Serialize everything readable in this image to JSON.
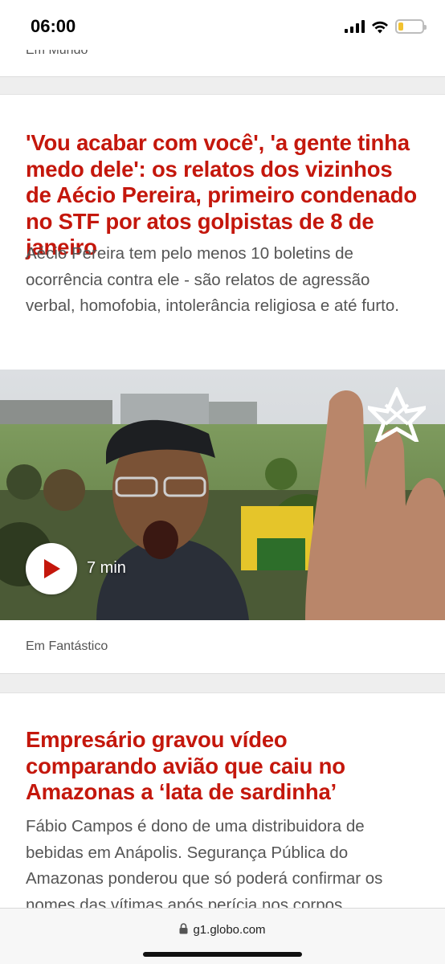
{
  "status_bar": {
    "time": "06:00",
    "battery_percent": 20
  },
  "top_card": {
    "source": "Em Mundo"
  },
  "article_1": {
    "headline": "'Vou acabar com você', 'a gente tinha medo dele': os relatos dos vizinhos de Aécio Pereira, primeiro condenado no STF por atos golpistas de 8 de janeiro",
    "summary": "Aécio Pereira tem pelo menos 10 boletins de ocorrência contra ele - são relatos de agressão verbal, homofobia, intolerância religiosa e até furto.",
    "video_duration": "7 min",
    "source": "Em Fantástico"
  },
  "article_2": {
    "headline": "Empresário gravou vídeo comparando avião que caiu no Amazonas a ‘lata de sardinha’",
    "summary": "Fábio Campos é dono de uma distribuidora de bebidas em Anápolis. Segurança Pública do Amazonas ponderou que só poderá confirmar os nomes das vítimas após perícia nos corpos."
  },
  "url_bar": {
    "url": "g1.globo.com"
  },
  "colors": {
    "headline": "#c4170c",
    "summary": "#555555",
    "background": "#eeeeee"
  },
  "icons": [
    "signal-icon",
    "wifi-icon",
    "battery-icon",
    "play-icon",
    "fantastico-logo",
    "lock-icon"
  ]
}
